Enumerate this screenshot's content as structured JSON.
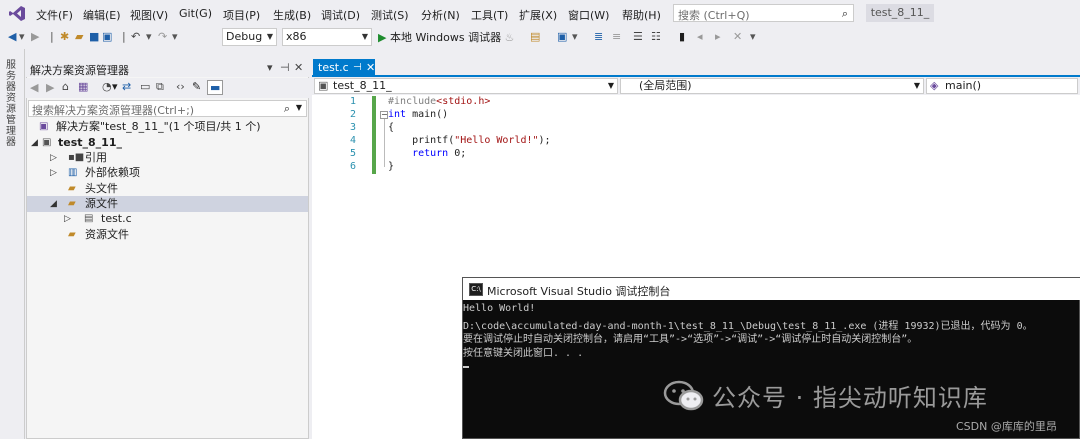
{
  "menu": {
    "items": [
      "文件(F)",
      "编辑(E)",
      "视图(V)",
      "Git(G)",
      "项目(P)",
      "生成(B)",
      "调试(D)",
      "测试(S)",
      "分析(N)",
      "工具(T)",
      "扩展(X)",
      "窗口(W)",
      "帮助(H)"
    ],
    "search_placeholder": "搜索 (Ctrl+Q)",
    "solution_name_badge": "test_8_11_"
  },
  "toolbar": {
    "config": "Debug",
    "platform": "x86",
    "run_label": "本地 Windows 调试器"
  },
  "left_strip_label": "服务器资源管理器",
  "solution_explorer": {
    "title": "解决方案资源管理器",
    "search_placeholder": "搜索解决方案资源管理器(Ctrl+;)",
    "tree": [
      {
        "label": "解决方案\"test_8_11_\"(1 个项目/共 1 个)"
      },
      {
        "label": "test_8_11_"
      },
      {
        "label": "引用"
      },
      {
        "label": "外部依赖项"
      },
      {
        "label": "头文件"
      },
      {
        "label": "源文件"
      },
      {
        "label": "test.c"
      },
      {
        "label": "资源文件"
      }
    ]
  },
  "editor": {
    "tab_name": "test.c",
    "nav_project": "test_8_11_",
    "nav_scope": "(全局范围)",
    "nav_member": "main()",
    "line_numbers": [
      "1",
      "2",
      "3",
      "4",
      "5",
      "6"
    ],
    "code": {
      "l1a": "#include",
      "l1b": "<stdio.h>",
      "l2a": "int",
      "l2b": " main()",
      "l3": "{",
      "l4a": "    printf(",
      "l4b": "\"Hello World!\"",
      "l4c": ");",
      "l5a": "    return",
      "l5b": " 0;",
      "l6": "}"
    }
  },
  "console": {
    "title": "Microsoft Visual Studio 调试控制台",
    "lines": [
      "Hello World!",
      "D:\\code\\accumulated-day-and-month-1\\test_8_11_\\Debug\\test_8_11_.exe (进程 19932)已退出，代码为 0。",
      "要在调试停止时自动关闭控制台，请启用“工具”->“选项”->“调试”->“调试停止时自动关闭控制台”。",
      "按任意键关闭此窗口. . ."
    ]
  },
  "watermark": {
    "text": "公众号 · 指尖动听知识库",
    "csdn": "CSDN @库库的里昂"
  }
}
